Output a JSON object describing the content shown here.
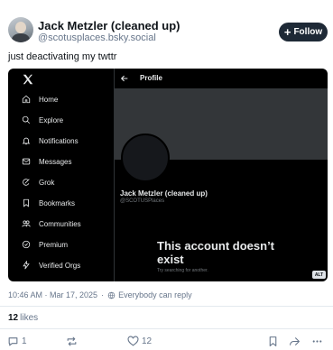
{
  "author": {
    "display_name": "Jack Metzler (cleaned up)",
    "handle": "@scotusplaces.bsky.social"
  },
  "follow_button": {
    "label": "Follow"
  },
  "post": {
    "text": "just deactivating my twttr"
  },
  "embed": {
    "sidebar": {
      "items": [
        {
          "label": "Home",
          "icon": "home-icon"
        },
        {
          "label": "Explore",
          "icon": "search-icon"
        },
        {
          "label": "Notifications",
          "icon": "bell-icon"
        },
        {
          "label": "Messages",
          "icon": "mail-icon"
        },
        {
          "label": "Grok",
          "icon": "grok-icon"
        },
        {
          "label": "Bookmarks",
          "icon": "bookmark-icon"
        },
        {
          "label": "Communities",
          "icon": "people-icon"
        },
        {
          "label": "Premium",
          "icon": "premium-icon"
        },
        {
          "label": "Verified Orgs",
          "icon": "lightning-icon"
        }
      ]
    },
    "header_title": "Profile",
    "profile_name": "Jack Metzler (cleaned up)",
    "profile_handle": "@SCOTUSPlaces",
    "error_title": "This account doesn’t exist",
    "error_subtitle": "Try searching for another.",
    "alt_badge": "ALT"
  },
  "meta": {
    "timestamp": "10:46 AM · Mar 17, 2025",
    "reply_setting": "Everybody can reply"
  },
  "likes": {
    "count": "12",
    "label": "likes"
  },
  "actions": {
    "reply_count": "1",
    "like_count": "12"
  },
  "colors": {
    "follow_bg": "#1e2936",
    "embed_bg": "#000000",
    "secondary_text": "#66758a"
  }
}
